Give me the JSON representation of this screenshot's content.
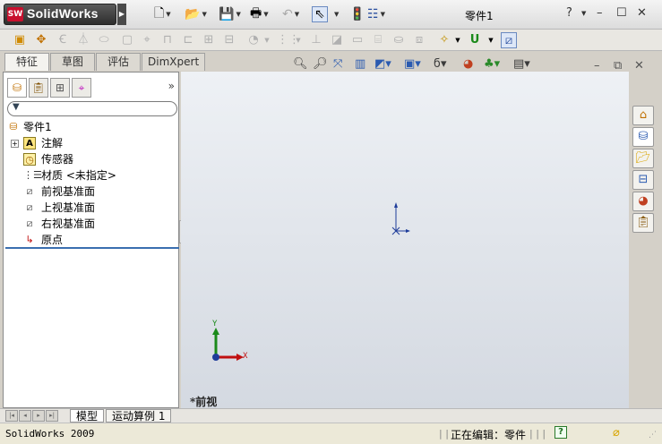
{
  "app": {
    "logo_badge": "SW",
    "logo_text": "SolidWorks",
    "document_title": "零件1"
  },
  "window_controls": {
    "help": "?",
    "minimize": "–",
    "maximize": "☐",
    "close": "✕"
  },
  "tabs": [
    {
      "label": "特征",
      "active": true
    },
    {
      "label": "草图",
      "active": false
    },
    {
      "label": "评估",
      "active": false
    },
    {
      "label": "DimXpert",
      "active": false
    }
  ],
  "feature_tree": {
    "root": "零件1",
    "items": [
      {
        "label": "注解",
        "expandable": true
      },
      {
        "label": "传感器",
        "expandable": false
      },
      {
        "label": "材质 <未指定>",
        "expandable": false
      },
      {
        "label": "前视基准面",
        "expandable": false
      },
      {
        "label": "上视基准面",
        "expandable": false
      },
      {
        "label": "右视基准面",
        "expandable": false
      },
      {
        "label": "原点",
        "expandable": false
      }
    ]
  },
  "viewport": {
    "view_name": "*前视",
    "triad_x": "X",
    "triad_y": "Y"
  },
  "bottom_tabs": [
    {
      "label": "模型",
      "active": true
    },
    {
      "label": "运动算例 1",
      "active": false
    }
  ],
  "status": {
    "app_version": "SolidWorks 2009",
    "editing": "正在编辑：零件"
  },
  "colors": {
    "logo_red": "#c8102e",
    "selection_line": "#3a6fb0",
    "triad_x": "#c01010",
    "triad_y": "#1a8a1a",
    "origin_blue": "#1e3c9a"
  }
}
